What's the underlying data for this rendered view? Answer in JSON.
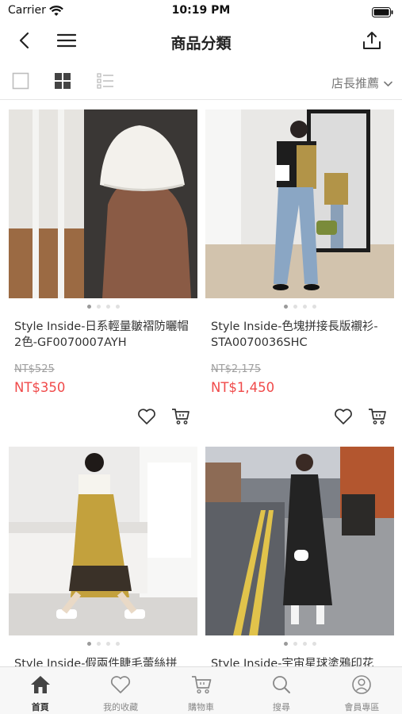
{
  "status_bar": {
    "carrier": "Carrier",
    "time": "10:19 PM"
  },
  "nav": {
    "title": "商品分類",
    "back_icon": "chevron-left-icon",
    "menu_icon": "hamburger-icon",
    "share_icon": "share-icon"
  },
  "toolbar": {
    "view_modes": [
      "single",
      "grid",
      "list"
    ],
    "active_view": "grid",
    "sort_label": "店長推薦"
  },
  "products": [
    {
      "title": "Style Inside-日系輕量皺褶防曬帽 2色-GF0070007AYH",
      "original_price": "NT$525",
      "sale_price": "NT$350"
    },
    {
      "title": "Style Inside-色塊拼接長版襯衫-STA0070036SHC",
      "original_price": "NT$2,175",
      "sale_price": "NT$1,450"
    },
    {
      "title": "Style Inside-假兩件睫毛蕾絲拼",
      "original_price": "",
      "sale_price": ""
    },
    {
      "title": "Style Inside-宇宙星球塗鴉印花",
      "original_price": "",
      "sale_price": ""
    }
  ],
  "tabs": [
    {
      "label": "首頁",
      "icon": "home-icon",
      "active": true
    },
    {
      "label": "我的收藏",
      "icon": "heart-icon",
      "active": false
    },
    {
      "label": "購物車",
      "icon": "cart-icon",
      "active": false
    },
    {
      "label": "搜尋",
      "icon": "search-icon",
      "active": false
    },
    {
      "label": "會員專區",
      "icon": "user-icon",
      "active": false
    }
  ],
  "colors": {
    "accent_price": "#f04a4a",
    "strike_price": "#a0a0a0",
    "tab_active": "#333333",
    "tab_inactive": "#888888"
  }
}
